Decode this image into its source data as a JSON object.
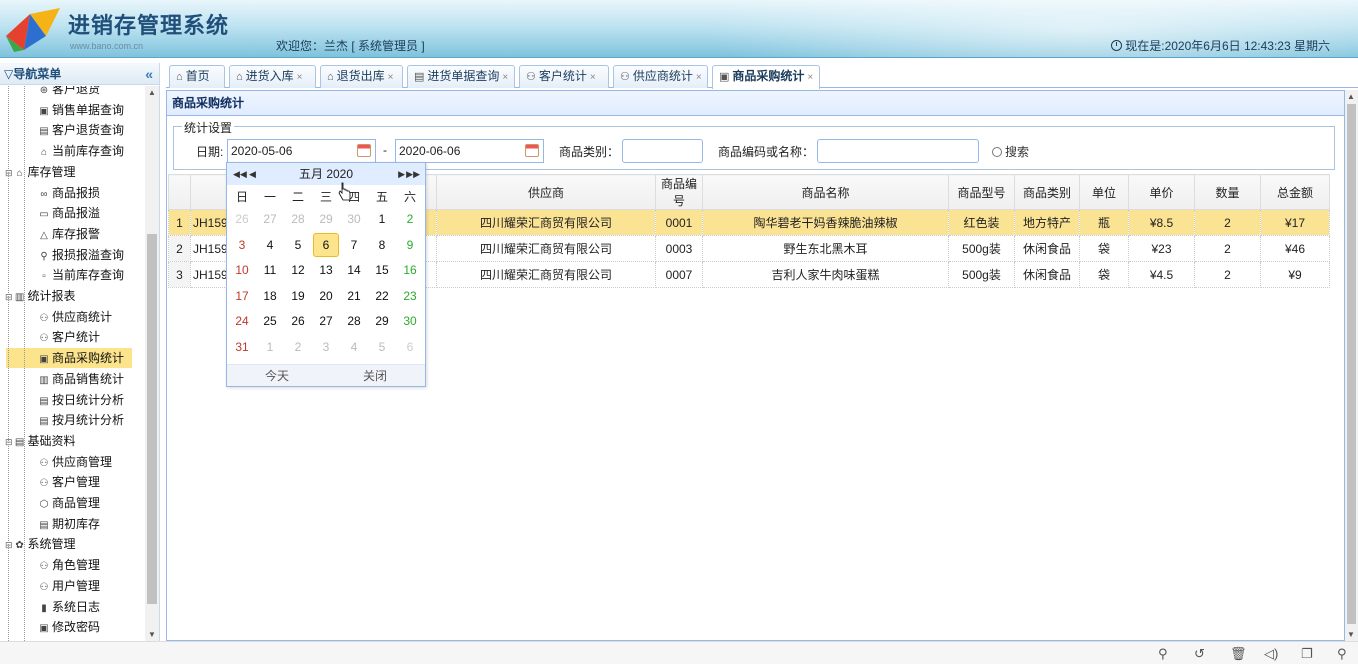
{
  "header": {
    "app_title": "进销存管理系统",
    "logo_url": "www.bano.com.cn",
    "welcome": "欢迎您：兰杰 [ 系统管理员 ]",
    "now_time": "现在是:2020年6月6日 12:43:23 星期六"
  },
  "sidebar": {
    "title": "导航菜单",
    "collapse": "«",
    "items": [
      {
        "label": "客户退货",
        "icon": "⊛"
      },
      {
        "label": "销售单据查询",
        "icon": "▣"
      },
      {
        "label": "客户退货查询",
        "icon": "▤"
      },
      {
        "label": "当前库存查询",
        "icon": "⌂"
      },
      {
        "label": "库存管理",
        "icon": "⌂"
      },
      {
        "label": "商品报损",
        "icon": "∞"
      },
      {
        "label": "商品报溢",
        "icon": "▭"
      },
      {
        "label": "库存报警",
        "icon": "△"
      },
      {
        "label": "报损报溢查询",
        "icon": "⚲"
      },
      {
        "label": "当前库存查询",
        "icon": "▫"
      },
      {
        "label": "统计报表",
        "icon": "▥"
      },
      {
        "label": "供应商统计",
        "icon": "⚇"
      },
      {
        "label": "客户统计",
        "icon": "⚇"
      },
      {
        "label": "商品采购统计",
        "icon": "▣"
      },
      {
        "label": "商品销售统计",
        "icon": "▥"
      },
      {
        "label": "按日统计分析",
        "icon": "▤"
      },
      {
        "label": "按月统计分析",
        "icon": "▤"
      },
      {
        "label": "基础资料",
        "icon": "▤"
      },
      {
        "label": "供应商管理",
        "icon": "⚇"
      },
      {
        "label": "客户管理",
        "icon": "⚇"
      },
      {
        "label": "商品管理",
        "icon": "⬡"
      },
      {
        "label": "期初库存",
        "icon": "▤"
      },
      {
        "label": "系统管理",
        "icon": "✿"
      },
      {
        "label": "角色管理",
        "icon": "⚇"
      },
      {
        "label": "用户管理",
        "icon": "⚇"
      },
      {
        "label": "系统日志",
        "icon": "▮"
      },
      {
        "label": "修改密码",
        "icon": "▣"
      }
    ]
  },
  "tabs": [
    {
      "label": "首页",
      "icon": "⌂",
      "closable": false
    },
    {
      "label": "进货入库",
      "icon": "⌂",
      "closable": true
    },
    {
      "label": "退货出库",
      "icon": "⌂",
      "closable": true
    },
    {
      "label": "进货单据查询",
      "icon": "▤",
      "closable": true
    },
    {
      "label": "客户统计",
      "icon": "⚇",
      "closable": true
    },
    {
      "label": "供应商统计",
      "icon": "⚇",
      "closable": true
    },
    {
      "label": "商品采购统计",
      "icon": "▣",
      "closable": true
    }
  ],
  "tab_close": "×",
  "panel": {
    "title": "商品采购统计",
    "legend": "统计设置",
    "date_label": "日期:",
    "date_from": "2020-05-06",
    "date_sep": "-",
    "date_to": "2020-06-06",
    "category_label": "商品类别：",
    "category_value": "",
    "code_label": "商品编码或名称：",
    "code_value": "",
    "search_label": "搜索"
  },
  "grid": {
    "columns": [
      "",
      "",
      "供应商",
      "商品编号",
      "商品名称",
      "商品型号",
      "商品类别",
      "单位",
      "单价",
      "数量",
      "总金额"
    ],
    "rows": [
      [
        "1",
        "JH159",
        "四川耀荣汇商贸有限公司",
        "0001",
        "陶华碧老干妈香辣脆油辣椒",
        "红色装",
        "地方特产",
        "瓶",
        "¥8.5",
        "2",
        "¥17"
      ],
      [
        "2",
        "JH159",
        "四川耀荣汇商贸有限公司",
        "0003",
        "野生东北黑木耳",
        "500g装",
        "休闲食品",
        "袋",
        "¥23",
        "2",
        "¥46"
      ],
      [
        "3",
        "JH159",
        "四川耀荣汇商贸有限公司",
        "0007",
        "吉利人家牛肉味蛋糕",
        "500g装",
        "休闲食品",
        "袋",
        "¥4.5",
        "2",
        "¥9"
      ]
    ]
  },
  "calendar": {
    "title": "五月 2020",
    "weekdays": [
      "日",
      "一",
      "二",
      "三",
      "四",
      "五",
      "六"
    ],
    "days": [
      [
        "26",
        "27",
        "28",
        "29",
        "30",
        "1",
        "2"
      ],
      [
        "3",
        "4",
        "5",
        "6",
        "7",
        "8",
        "9"
      ],
      [
        "10",
        "11",
        "12",
        "13",
        "14",
        "15",
        "16"
      ],
      [
        "17",
        "18",
        "19",
        "20",
        "21",
        "22",
        "23"
      ],
      [
        "24",
        "25",
        "26",
        "27",
        "28",
        "29",
        "30"
      ],
      [
        "31",
        "1",
        "2",
        "3",
        "4",
        "5",
        "6"
      ]
    ],
    "today_label": "今天",
    "close_label": "关闭",
    "highlighted_day": "6"
  },
  "colors": {
    "selected_row": "#fbe394",
    "header_bg": "#bfe3f1",
    "accent": "#95b8e7"
  }
}
